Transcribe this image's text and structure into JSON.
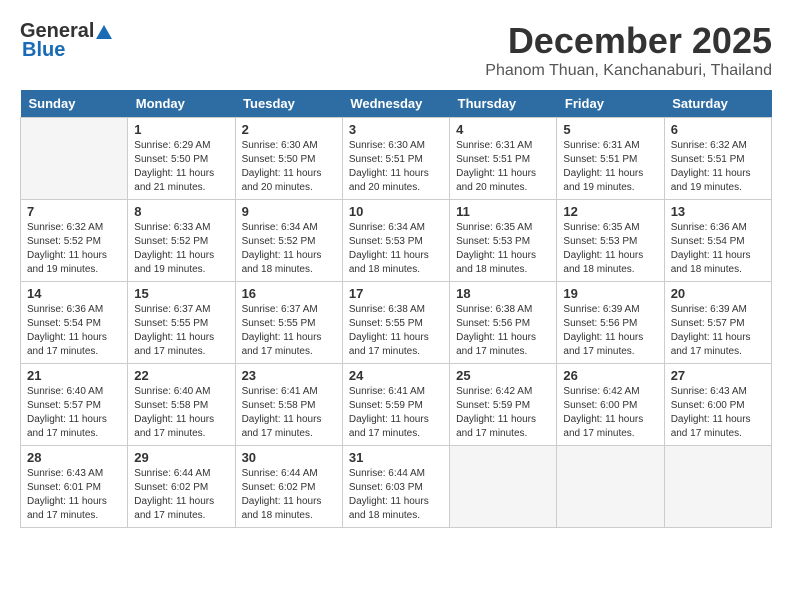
{
  "logo": {
    "general": "General",
    "blue": "Blue"
  },
  "title": "December 2025",
  "subtitle": "Phanom Thuan, Kanchanaburi, Thailand",
  "days_of_week": [
    "Sunday",
    "Monday",
    "Tuesday",
    "Wednesday",
    "Thursday",
    "Friday",
    "Saturday"
  ],
  "weeks": [
    [
      {
        "day": "",
        "info": ""
      },
      {
        "day": "1",
        "info": "Sunrise: 6:29 AM\nSunset: 5:50 PM\nDaylight: 11 hours\nand 21 minutes."
      },
      {
        "day": "2",
        "info": "Sunrise: 6:30 AM\nSunset: 5:50 PM\nDaylight: 11 hours\nand 20 minutes."
      },
      {
        "day": "3",
        "info": "Sunrise: 6:30 AM\nSunset: 5:51 PM\nDaylight: 11 hours\nand 20 minutes."
      },
      {
        "day": "4",
        "info": "Sunrise: 6:31 AM\nSunset: 5:51 PM\nDaylight: 11 hours\nand 20 minutes."
      },
      {
        "day": "5",
        "info": "Sunrise: 6:31 AM\nSunset: 5:51 PM\nDaylight: 11 hours\nand 19 minutes."
      },
      {
        "day": "6",
        "info": "Sunrise: 6:32 AM\nSunset: 5:51 PM\nDaylight: 11 hours\nand 19 minutes."
      }
    ],
    [
      {
        "day": "7",
        "info": "Sunrise: 6:32 AM\nSunset: 5:52 PM\nDaylight: 11 hours\nand 19 minutes."
      },
      {
        "day": "8",
        "info": "Sunrise: 6:33 AM\nSunset: 5:52 PM\nDaylight: 11 hours\nand 19 minutes."
      },
      {
        "day": "9",
        "info": "Sunrise: 6:34 AM\nSunset: 5:52 PM\nDaylight: 11 hours\nand 18 minutes."
      },
      {
        "day": "10",
        "info": "Sunrise: 6:34 AM\nSunset: 5:53 PM\nDaylight: 11 hours\nand 18 minutes."
      },
      {
        "day": "11",
        "info": "Sunrise: 6:35 AM\nSunset: 5:53 PM\nDaylight: 11 hours\nand 18 minutes."
      },
      {
        "day": "12",
        "info": "Sunrise: 6:35 AM\nSunset: 5:53 PM\nDaylight: 11 hours\nand 18 minutes."
      },
      {
        "day": "13",
        "info": "Sunrise: 6:36 AM\nSunset: 5:54 PM\nDaylight: 11 hours\nand 18 minutes."
      }
    ],
    [
      {
        "day": "14",
        "info": "Sunrise: 6:36 AM\nSunset: 5:54 PM\nDaylight: 11 hours\nand 17 minutes."
      },
      {
        "day": "15",
        "info": "Sunrise: 6:37 AM\nSunset: 5:55 PM\nDaylight: 11 hours\nand 17 minutes."
      },
      {
        "day": "16",
        "info": "Sunrise: 6:37 AM\nSunset: 5:55 PM\nDaylight: 11 hours\nand 17 minutes."
      },
      {
        "day": "17",
        "info": "Sunrise: 6:38 AM\nSunset: 5:55 PM\nDaylight: 11 hours\nand 17 minutes."
      },
      {
        "day": "18",
        "info": "Sunrise: 6:38 AM\nSunset: 5:56 PM\nDaylight: 11 hours\nand 17 minutes."
      },
      {
        "day": "19",
        "info": "Sunrise: 6:39 AM\nSunset: 5:56 PM\nDaylight: 11 hours\nand 17 minutes."
      },
      {
        "day": "20",
        "info": "Sunrise: 6:39 AM\nSunset: 5:57 PM\nDaylight: 11 hours\nand 17 minutes."
      }
    ],
    [
      {
        "day": "21",
        "info": "Sunrise: 6:40 AM\nSunset: 5:57 PM\nDaylight: 11 hours\nand 17 minutes."
      },
      {
        "day": "22",
        "info": "Sunrise: 6:40 AM\nSunset: 5:58 PM\nDaylight: 11 hours\nand 17 minutes."
      },
      {
        "day": "23",
        "info": "Sunrise: 6:41 AM\nSunset: 5:58 PM\nDaylight: 11 hours\nand 17 minutes."
      },
      {
        "day": "24",
        "info": "Sunrise: 6:41 AM\nSunset: 5:59 PM\nDaylight: 11 hours\nand 17 minutes."
      },
      {
        "day": "25",
        "info": "Sunrise: 6:42 AM\nSunset: 5:59 PM\nDaylight: 11 hours\nand 17 minutes."
      },
      {
        "day": "26",
        "info": "Sunrise: 6:42 AM\nSunset: 6:00 PM\nDaylight: 11 hours\nand 17 minutes."
      },
      {
        "day": "27",
        "info": "Sunrise: 6:43 AM\nSunset: 6:00 PM\nDaylight: 11 hours\nand 17 minutes."
      }
    ],
    [
      {
        "day": "28",
        "info": "Sunrise: 6:43 AM\nSunset: 6:01 PM\nDaylight: 11 hours\nand 17 minutes."
      },
      {
        "day": "29",
        "info": "Sunrise: 6:44 AM\nSunset: 6:02 PM\nDaylight: 11 hours\nand 17 minutes."
      },
      {
        "day": "30",
        "info": "Sunrise: 6:44 AM\nSunset: 6:02 PM\nDaylight: 11 hours\nand 18 minutes."
      },
      {
        "day": "31",
        "info": "Sunrise: 6:44 AM\nSunset: 6:03 PM\nDaylight: 11 hours\nand 18 minutes."
      },
      {
        "day": "",
        "info": ""
      },
      {
        "day": "",
        "info": ""
      },
      {
        "day": "",
        "info": ""
      }
    ]
  ]
}
